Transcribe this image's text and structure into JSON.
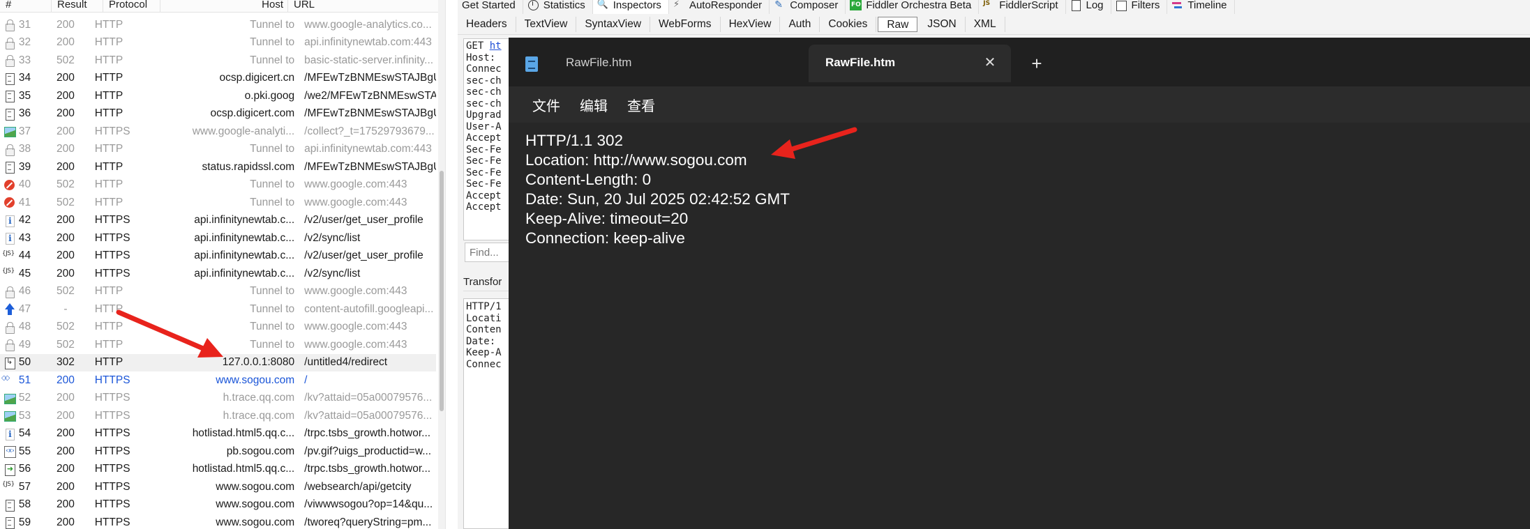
{
  "grid": {
    "headers": [
      "#",
      "Result",
      "Protocol",
      "Host",
      "URL"
    ],
    "rows": [
      {
        "icon": "lock-icon",
        "num": "31",
        "result": "200",
        "protocol": "HTTP",
        "host": "Tunnel to",
        "url": "www.google-analytics.co...",
        "style": "tunnel"
      },
      {
        "icon": "lock-icon",
        "num": "32",
        "result": "200",
        "protocol": "HTTP",
        "host": "Tunnel to",
        "url": "api.infinitynewtab.com:443",
        "style": "tunnel"
      },
      {
        "icon": "lock-icon",
        "num": "33",
        "result": "502",
        "protocol": "HTTP",
        "host": "Tunnel to",
        "url": "basic-static-server.infinity...",
        "style": "tunnel"
      },
      {
        "icon": "document-icon",
        "num": "34",
        "result": "200",
        "protocol": "HTTP",
        "host": "ocsp.digicert.cn",
        "url": "/MFEwTzBNMEswSTAJBgU...",
        "style": "normal"
      },
      {
        "icon": "document-icon",
        "num": "35",
        "result": "200",
        "protocol": "HTTP",
        "host": "o.pki.goog",
        "url": "/we2/MFEwTzBNMEswSTA...",
        "style": "normal"
      },
      {
        "icon": "document-icon",
        "num": "36",
        "result": "200",
        "protocol": "HTTP",
        "host": "ocsp.digicert.com",
        "url": "/MFEwTzBNMEswSTAJBgU...",
        "style": "normal"
      },
      {
        "icon": "image-icon",
        "num": "37",
        "result": "200",
        "protocol": "HTTPS",
        "host": "www.google-analyti...",
        "url": "/collect?_t=17529793679...",
        "style": "tunnel"
      },
      {
        "icon": "lock-icon",
        "num": "38",
        "result": "200",
        "protocol": "HTTP",
        "host": "Tunnel to",
        "url": "api.infinitynewtab.com:443",
        "style": "tunnel"
      },
      {
        "icon": "document-icon",
        "num": "39",
        "result": "200",
        "protocol": "HTTP",
        "host": "status.rapidssl.com",
        "url": "/MFEwTzBNMEswSTAJBgU...",
        "style": "normal"
      },
      {
        "icon": "blocked-icon",
        "num": "40",
        "result": "502",
        "protocol": "HTTP",
        "host": "Tunnel to",
        "url": "www.google.com:443",
        "style": "tunnel"
      },
      {
        "icon": "blocked-icon",
        "num": "41",
        "result": "502",
        "protocol": "HTTP",
        "host": "Tunnel to",
        "url": "www.google.com:443",
        "style": "tunnel"
      },
      {
        "icon": "info-icon",
        "num": "42",
        "result": "200",
        "protocol": "HTTPS",
        "host": "api.infinitynewtab.c...",
        "url": "/v2/user/get_user_profile",
        "style": "normal"
      },
      {
        "icon": "info-icon",
        "num": "43",
        "result": "200",
        "protocol": "HTTPS",
        "host": "api.infinitynewtab.c...",
        "url": "/v2/sync/list",
        "style": "normal"
      },
      {
        "icon": "json-icon",
        "num": "44",
        "result": "200",
        "protocol": "HTTPS",
        "host": "api.infinitynewtab.c...",
        "url": "/v2/user/get_user_profile",
        "style": "normal"
      },
      {
        "icon": "json-icon",
        "num": "45",
        "result": "200",
        "protocol": "HTTPS",
        "host": "api.infinitynewtab.c...",
        "url": "/v2/sync/list",
        "style": "normal"
      },
      {
        "icon": "lock-icon",
        "num": "46",
        "result": "502",
        "protocol": "HTTP",
        "host": "Tunnel to",
        "url": "www.google.com:443",
        "style": "tunnel"
      },
      {
        "icon": "upload-arrow-icon",
        "num": "47",
        "result": "-",
        "protocol": "HTTP",
        "host": "Tunnel to",
        "url": "content-autofill.googleapi...",
        "style": "tunnel"
      },
      {
        "icon": "lock-icon",
        "num": "48",
        "result": "502",
        "protocol": "HTTP",
        "host": "Tunnel to",
        "url": "www.google.com:443",
        "style": "tunnel"
      },
      {
        "icon": "lock-icon",
        "num": "49",
        "result": "502",
        "protocol": "HTTP",
        "host": "Tunnel to",
        "url": "www.google.com:443",
        "style": "tunnel"
      },
      {
        "icon": "redirect-icon",
        "num": "50",
        "result": "302",
        "protocol": "HTTP",
        "host": "127.0.0.1:8080",
        "url": "/untitled4/redirect",
        "style": "selected"
      },
      {
        "icon": "diamond-icon",
        "num": "51",
        "result": "200",
        "protocol": "HTTPS",
        "host": "www.sogou.com",
        "url": "/",
        "style": "blue"
      },
      {
        "icon": "image-icon",
        "num": "52",
        "result": "200",
        "protocol": "HTTPS",
        "host": "h.trace.qq.com",
        "url": "/kv?attaid=05a00079576...",
        "style": "tunnel"
      },
      {
        "icon": "image-icon",
        "num": "53",
        "result": "200",
        "protocol": "HTTPS",
        "host": "h.trace.qq.com",
        "url": "/kv?attaid=05a00079576...",
        "style": "tunnel"
      },
      {
        "icon": "info-icon",
        "num": "54",
        "result": "200",
        "protocol": "HTTPS",
        "host": "hotlistad.html5.qq.c...",
        "url": "/trpc.tsbs_growth.hotwor...",
        "style": "normal"
      },
      {
        "icon": "xml-icon",
        "num": "55",
        "result": "200",
        "protocol": "HTTPS",
        "host": "pb.sogou.com",
        "url": "/pv.gif?uigs_productid=w...",
        "style": "normal"
      },
      {
        "icon": "forward-icon",
        "num": "56",
        "result": "200",
        "protocol": "HTTPS",
        "host": "hotlistad.html5.qq.c...",
        "url": "/trpc.tsbs_growth.hotwor...",
        "style": "normal"
      },
      {
        "icon": "json-icon",
        "num": "57",
        "result": "200",
        "protocol": "HTTPS",
        "host": "www.sogou.com",
        "url": "/websearch/api/getcity",
        "style": "normal"
      },
      {
        "icon": "document-icon",
        "num": "58",
        "result": "200",
        "protocol": "HTTPS",
        "host": "www.sogou.com",
        "url": "/viwwwsogou?op=14&qu...",
        "style": "normal"
      },
      {
        "icon": "document-icon",
        "num": "59",
        "result": "200",
        "protocol": "HTTPS",
        "host": "www.sogou.com",
        "url": "/tworeq?queryString=pm...",
        "style": "normal"
      }
    ]
  },
  "top_tabs": [
    {
      "label": "Get Started",
      "icon": ""
    },
    {
      "label": "Statistics",
      "icon": "stats-icon"
    },
    {
      "label": "Inspectors",
      "icon": "inspectors-icon"
    },
    {
      "label": "AutoResponder",
      "icon": "bolt-icon"
    },
    {
      "label": "Composer",
      "icon": "composer-icon"
    },
    {
      "label": "Fiddler Orchestra Beta",
      "icon": "fo-icon"
    },
    {
      "label": "FiddlerScript",
      "icon": "script-icon"
    },
    {
      "label": "Log",
      "icon": "log-icon"
    },
    {
      "label": "Filters",
      "icon": "filters-icon"
    },
    {
      "label": "Timeline",
      "icon": "timeline-icon"
    }
  ],
  "sub_tabs": [
    "Headers",
    "TextView",
    "SyntaxView",
    "WebForms",
    "HexView",
    "Auth",
    "Cookies",
    "Raw",
    "JSON",
    "XML"
  ],
  "active_sub_tab": "Raw",
  "request_pane": {
    "first_line_method": "GET ",
    "first_line_link": "ht",
    "lines": [
      "Host:",
      "Connec",
      "sec-ch",
      "sec-ch",
      "sec-ch",
      "Upgrad",
      "User-A",
      "Accept",
      "Sec-Fe",
      "Sec-Fe",
      "Sec-Fe",
      "Sec-Fe",
      "Accept",
      "Accept"
    ]
  },
  "find_placeholder": "Find...",
  "transform_tab_label": "Transfor",
  "response_pane": {
    "lines": [
      "HTTP/1",
      "Locati",
      "Conten",
      "Date: ",
      "Keep-A",
      "Connec"
    ]
  },
  "notepad": {
    "tab1_label": "RawFile.htm",
    "tab2_label": "RawFile.htm",
    "close_glyph": "✕",
    "new_tab_glyph": "+",
    "menu": [
      "文件",
      "编辑",
      "查看"
    ],
    "content_lines": [
      "HTTP/1.1 302",
      "Location: http://www.sogou.com",
      "Content-Length: 0",
      "Date: Sun, 20 Jul 2025 02:42:52 GMT",
      "Keep-Alive: timeout=20",
      "Connection: keep-alive"
    ]
  },
  "colors": {
    "arrow": "#e8231c",
    "link_blue": "#1a55d8",
    "notepad_bg": "#272727"
  }
}
